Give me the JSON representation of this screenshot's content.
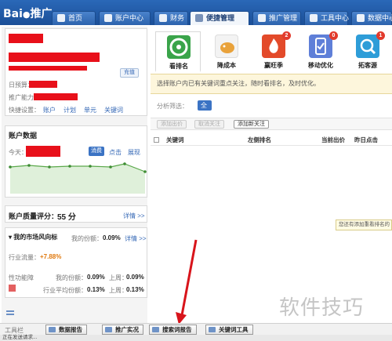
{
  "logo": {
    "text": "Bai",
    "paw": "●",
    "suffix": "推广"
  },
  "nav": [
    {
      "label": "首页"
    },
    {
      "label": "账户中心"
    },
    {
      "label": "财务"
    },
    {
      "label": "便捷管理",
      "active": true
    },
    {
      "label": "推广管理"
    },
    {
      "label": "工具中心"
    },
    {
      "label": "数据中心"
    }
  ],
  "account": {
    "query_button": "充值",
    "daily_budget_label": "日预算：",
    "promo_ability_label": "推广能力：",
    "quick_settings_label": "快捷设置：",
    "quick_links": [
      "账户",
      "计划",
      "单元",
      "关键词"
    ]
  },
  "account_data": {
    "title": "账户数据",
    "today_label": "今天：",
    "tabs": [
      "消费",
      "点击",
      "展现"
    ]
  },
  "quality": {
    "label": "账户质量评分：",
    "score": "55 分",
    "detail_link": "详情 >>"
  },
  "market": {
    "title": "我的市场风向标",
    "my_share_label": "我的份额：",
    "my_share_value": "0.09%",
    "detail_link": "详情 >>",
    "traffic_label": "行业流量：",
    "traffic_value": "+7.88%",
    "capacity_label": "性功能障",
    "row1_my_label": "我的份额：",
    "row1_my_value": "0.09%",
    "row1_prev_label": "上周：",
    "row1_prev_value": "0.09%",
    "row2_avg_label": "行业平均份额：",
    "row2_avg_value": "0.13%",
    "row2_prev_label": "上周：",
    "row2_prev_value": "0.13%"
  },
  "tools": [
    {
      "label": "看排名",
      "color": "#3aa44a",
      "badge": "",
      "active": true
    },
    {
      "label": "降成本",
      "color": "#f0f0f0",
      "badge": ""
    },
    {
      "label": "赢旺季",
      "color": "#e34a2a",
      "badge": "2"
    },
    {
      "label": "移动优化",
      "color": "#5f7fd8",
      "badge": "0"
    },
    {
      "label": "拓客源",
      "color": "#2e9dd8",
      "badge": "1"
    }
  ],
  "notice": "选择账户内已有关键词重点关注，随时看排名，及时优化。",
  "filter": {
    "label": "分析筛选：",
    "tab": "全部(0)"
  },
  "actions": [
    {
      "label": "添加出价",
      "enabled": false
    },
    {
      "label": "取消关注",
      "enabled": false
    },
    {
      "label": "添加新关注",
      "enabled": true
    }
  ],
  "table_headers": [
    "关键词",
    "左侧排名",
    "当前出价",
    "昨日点击"
  ],
  "tooltip": "您还有添加重看排名的",
  "watermark": "软件技巧",
  "bottom_tools": [
    {
      "label": "数据报告"
    },
    {
      "label": "推广实况"
    },
    {
      "label": "搜索词报告"
    },
    {
      "label": "关键词工具"
    }
  ],
  "bottom_left_label": "工具栏",
  "status": "正在发送请求..."
}
